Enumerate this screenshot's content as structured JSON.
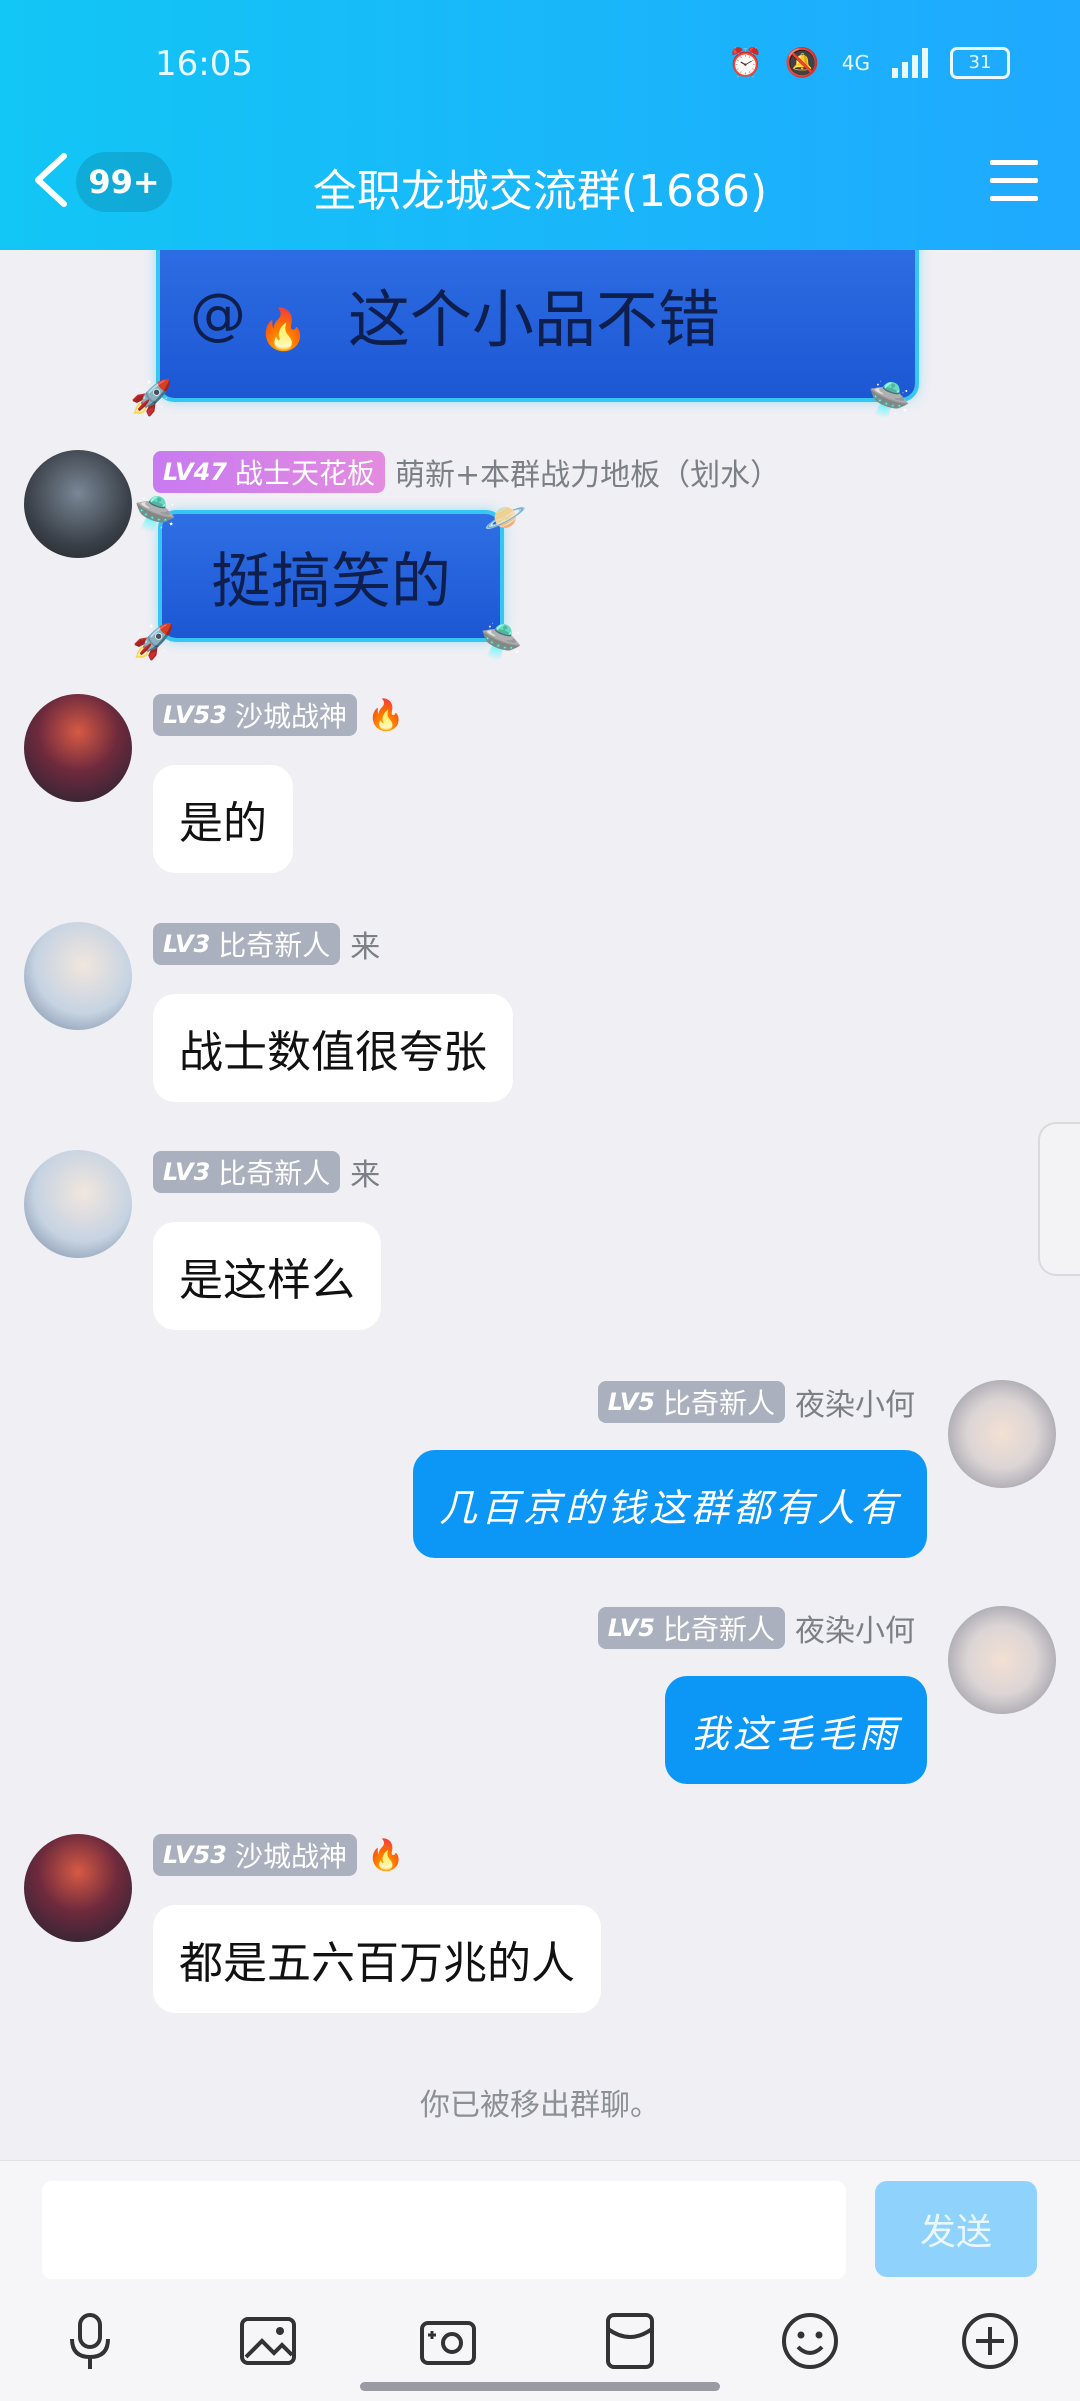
{
  "status_bar": {
    "time": "16:05",
    "network": "4G",
    "battery": "31"
  },
  "header": {
    "unread_badge": "99+",
    "title": "全职龙城交流群(1686)"
  },
  "messages": [
    {
      "type": "fancy",
      "text": "这个小品不错",
      "mention": "@"
    },
    {
      "sender": {
        "level": "LV47",
        "title": "战士天花板",
        "name": "萌新+本群战力地板（划水）"
      },
      "type": "fancy",
      "text": "挺搞笑的"
    },
    {
      "sender": {
        "level": "LV53",
        "title": "沙城战神",
        "name": ""
      },
      "text": "是的"
    },
    {
      "sender": {
        "level": "LV3",
        "title": "比奇新人",
        "name": "来"
      },
      "text": "战士数值很夸张"
    },
    {
      "sender": {
        "level": "LV3",
        "title": "比奇新人",
        "name": "来"
      },
      "text": "是这样么"
    },
    {
      "sender": {
        "level": "LV5",
        "title": "比奇新人",
        "name": "夜染小何"
      },
      "mine": true,
      "text": "几百京的钱这群都有人有"
    },
    {
      "sender": {
        "level": "LV5",
        "title": "比奇新人",
        "name": "夜染小何"
      },
      "mine": true,
      "text": "我这毛毛雨"
    },
    {
      "sender": {
        "level": "LV53",
        "title": "沙城战神",
        "name": ""
      },
      "text": "都是五六百万兆的人"
    }
  ],
  "system_note": "你已被移出群聊。",
  "input": {
    "placeholder": "",
    "send_label": "发送"
  },
  "colors": {
    "header_start": "#12c6f5",
    "header_end": "#1fa9ff",
    "my_bubble": "#0c96f5",
    "send_disabled": "#8fd2fb"
  }
}
